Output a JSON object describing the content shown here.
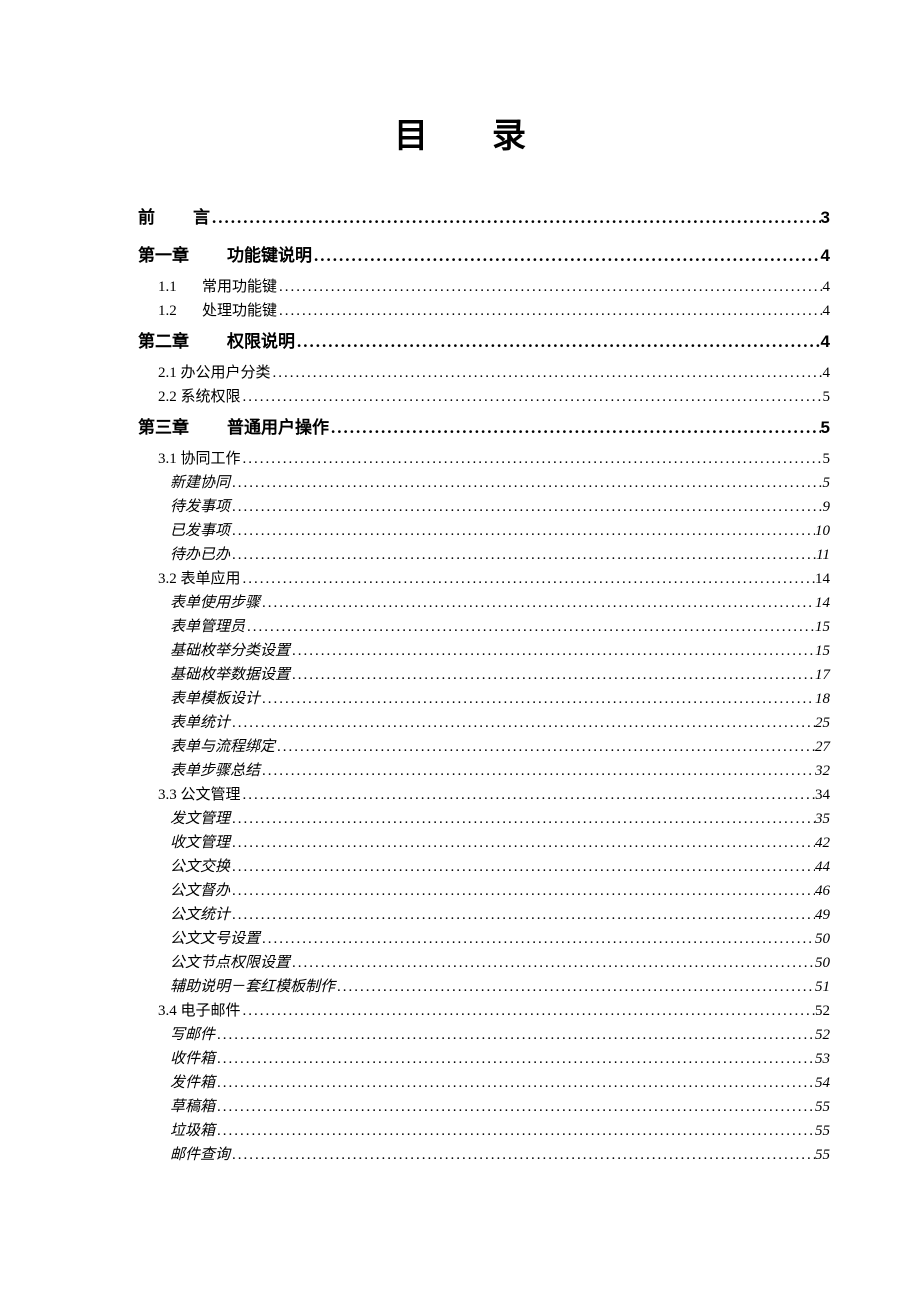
{
  "title": {
    "c1": "目",
    "c2": "录"
  },
  "e": [
    {
      "l1": "前",
      "l2": "言",
      "p": "3"
    },
    {
      "l1": "第一章",
      "l2": "功能键说明",
      "p": "4"
    },
    {
      "n": "1.1",
      "t": "常用功能键",
      "p": "4"
    },
    {
      "n": "1.2",
      "t": "处理功能键",
      "p": "4"
    },
    {
      "l1": "第二章",
      "l2": "权限说明",
      "p": "4"
    },
    {
      "t": "2.1 办公用户分类",
      "p": "4"
    },
    {
      "t": "2.2 系统权限",
      "p": "5"
    },
    {
      "l1": "第三章",
      "l2": "普通用户操作",
      "p": "5"
    },
    {
      "t": "3.1 协同工作",
      "p": "5"
    },
    {
      "t": "新建协同",
      "p": "5"
    },
    {
      "t": "待发事项",
      "p": "9"
    },
    {
      "t": "已发事项",
      "p": "10"
    },
    {
      "t": "待办已办",
      "p": "11"
    },
    {
      "t": "3.2 表单应用",
      "p": "14"
    },
    {
      "t": "表单使用步骤",
      "p": "14"
    },
    {
      "t": "表单管理员",
      "p": "15"
    },
    {
      "t": "基础枚举分类设置",
      "p": "15"
    },
    {
      "t": "基础枚举数据设置",
      "p": "17"
    },
    {
      "t": "表单模板设计",
      "p": "18"
    },
    {
      "t": "表单统计",
      "p": "25"
    },
    {
      "t": "表单与流程绑定",
      "p": "27"
    },
    {
      "t": "表单步骤总结",
      "p": "32"
    },
    {
      "t": "3.3 公文管理",
      "p": "34"
    },
    {
      "t": "发文管理",
      "p": "35"
    },
    {
      "t": "收文管理",
      "p": "42"
    },
    {
      "t": "公文交换",
      "p": "44"
    },
    {
      "t": "公文督办",
      "p": "46"
    },
    {
      "t": "公文统计",
      "p": "49"
    },
    {
      "t": "公文文号设置",
      "p": "50"
    },
    {
      "t": "公文节点权限设置",
      "p": "50"
    },
    {
      "t": "辅助说明－套红模板制作",
      "p": "51"
    },
    {
      "t": "3.4 电子邮件",
      "p": "52"
    },
    {
      "t": "写邮件",
      "p": "52"
    },
    {
      "t": "收件箱",
      "p": "53"
    },
    {
      "t": "发件箱",
      "p": "54"
    },
    {
      "t": "草稿箱",
      "p": "55"
    },
    {
      "t": "垃圾箱",
      "p": "55"
    },
    {
      "t": "邮件查询",
      "p": "55"
    }
  ]
}
